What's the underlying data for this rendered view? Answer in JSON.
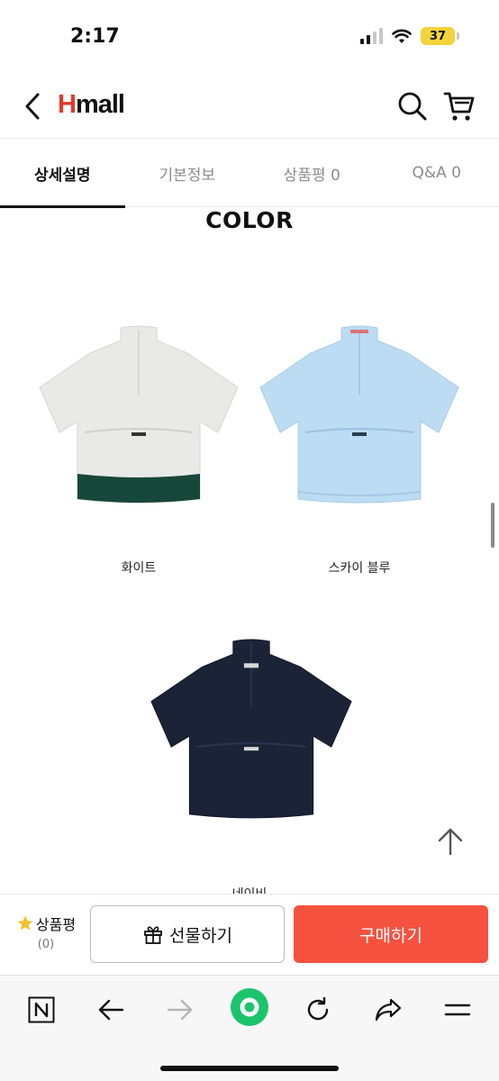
{
  "status_bar": {
    "time": "2:17",
    "battery": "37"
  },
  "header": {
    "logo_h": "H",
    "logo_rest": "mall"
  },
  "tabs": [
    {
      "label": "상세설명",
      "active": true
    },
    {
      "label": "기본정보",
      "active": false
    },
    {
      "label": "상품평 0",
      "active": false
    },
    {
      "label": "Q&A 0",
      "active": false
    }
  ],
  "content": {
    "section_title": "COLOR",
    "products": [
      {
        "caption": "화이트",
        "body_color": "#e9e9e8",
        "band_color": "#17473a"
      },
      {
        "caption": "스카이 블루",
        "body_color": "#bcdcf3",
        "band_color": "#bcdcf3"
      },
      {
        "caption": "네이비",
        "body_color": "#1b2336",
        "band_color": "#1b2336"
      }
    ]
  },
  "purchase_bar": {
    "review_label": "상품평",
    "review_count": "(0)",
    "gift_label": "선물하기",
    "buy_label": "구매하기"
  },
  "colors": {
    "brand_red": "#e8362b",
    "buy_button": "#f5513f",
    "star": "#f3c12b",
    "browser_home": "#1bc46b"
  },
  "icons": [
    "back-arrow-icon",
    "search-icon",
    "cart-icon",
    "scroll-to-top-icon",
    "star-icon",
    "gift-icon",
    "n-icon",
    "arrow-left-icon",
    "arrow-right-icon",
    "home-dot-icon",
    "reload-icon",
    "share-icon",
    "menu-icon"
  ]
}
